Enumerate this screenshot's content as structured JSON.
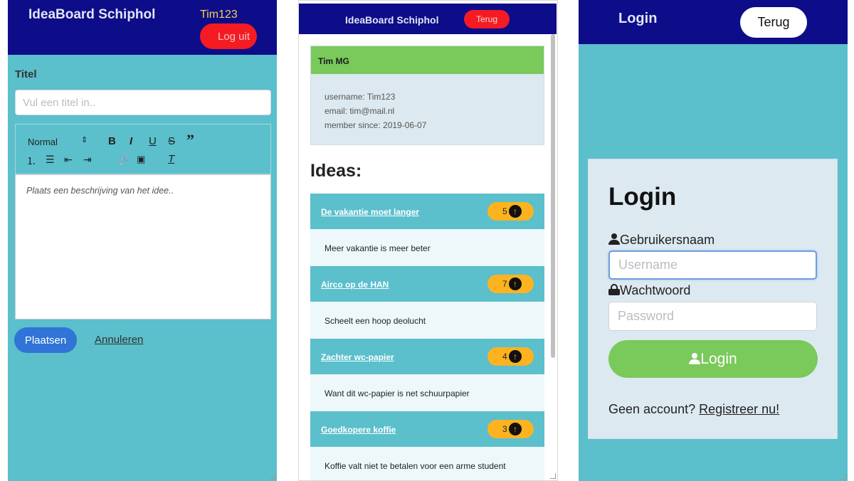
{
  "editor_panel": {
    "brand": "IdeaBoard Schiphol",
    "username": "Tim123",
    "logout_label": "Log uit",
    "title_label": "Titel",
    "title_placeholder": "Vul een titel in..",
    "toolbar": {
      "format_select": "Normal",
      "bold": "B",
      "italic": "I",
      "underline": "U",
      "strike": "S",
      "quote": "”",
      "clear": "T"
    },
    "description_placeholder": "Plaats een beschrijving van het idee..",
    "submit_label": "Plaatsen",
    "cancel_label": "Annuleren"
  },
  "profile_panel": {
    "brand": "IdeaBoard Schiphol",
    "back_label": "Terug",
    "profile": {
      "name": "Tim MG",
      "username_line": "username: Tim123",
      "email_line": "email: tim@mail.nl",
      "member_line": "member since: 2019-06-07"
    },
    "ideas_heading": "Ideas:",
    "ideas": [
      {
        "title": "De vakantie moet langer",
        "votes": "5",
        "description": "Meer vakantie is meer beter"
      },
      {
        "title": "Airco op de HAN",
        "votes": "7",
        "description": "Scheelt een hoop deolucht"
      },
      {
        "title": "Zachter wc-papier",
        "votes": "4",
        "description": "Want dit wc-papier is net schuurpapier"
      },
      {
        "title": "Goedkopere koffie",
        "votes": "3",
        "description": "Koffie valt niet te betalen voor een arme student"
      }
    ]
  },
  "login_panel": {
    "brand": "Login",
    "back_label": "Terug",
    "title": "Login",
    "username_label": "Gebruikersnaam",
    "username_placeholder": "Username",
    "password_label": "Wachtwoord",
    "password_placeholder": "Password",
    "login_button": "Login",
    "no_account_text": "Geen account?",
    "register_link": "Registreer nu!"
  },
  "colors": {
    "header": "#0d0d8a",
    "background": "#5bbfcc",
    "danger": "#f51b22",
    "success": "#7ac95b",
    "vote_badge": "#fdb320",
    "primary": "#2f74d6"
  }
}
